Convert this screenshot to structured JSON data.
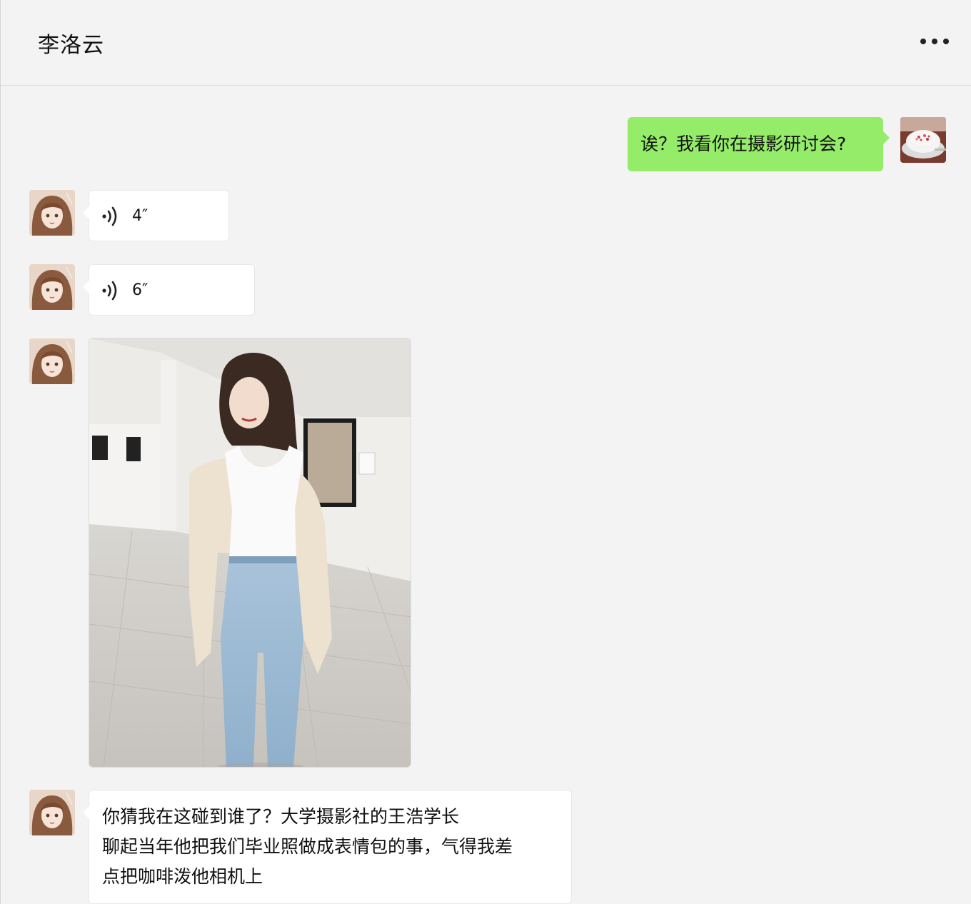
{
  "header": {
    "title": "李洛云"
  },
  "messages": {
    "m1": {
      "text": "诶？我看你在摄影研讨会?"
    },
    "m2": {
      "duration": "4″"
    },
    "m3": {
      "duration": "6″"
    },
    "m5": {
      "line1": "你猜我在这碰到谁了？大学摄影社的王浩学长",
      "line2": "聊起当年他把我们毕业照做成表情包的事，气得我差",
      "line3": "点把咖啡泼他相机上"
    }
  },
  "colors": {
    "sent_bubble": "#95ec69",
    "received_bubble": "#ffffff",
    "background": "#f3f3f3"
  }
}
